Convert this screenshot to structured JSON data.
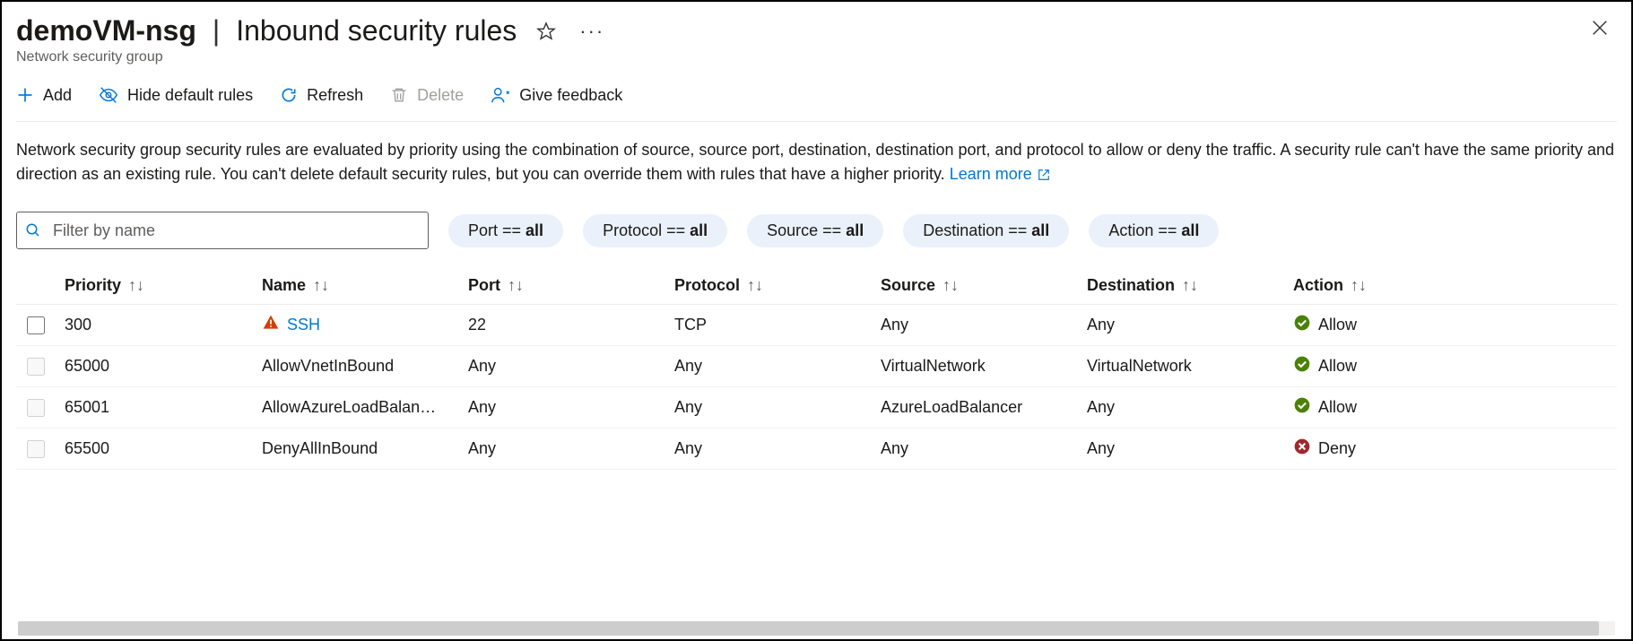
{
  "header": {
    "resource_name": "demoVM-nsg",
    "page_title": "Inbound security rules",
    "subtitle": "Network security group"
  },
  "toolbar": {
    "add": "Add",
    "hide": "Hide default rules",
    "refresh": "Refresh",
    "delete": "Delete",
    "feedback": "Give feedback"
  },
  "description": {
    "text": "Network security group security rules are evaluated by priority using the combination of source, source port, destination, destination port, and protocol to allow or deny the traffic. A security rule can't have the same priority and direction as an existing rule. You can't delete default security rules, but you can override them with rules that have a higher priority.",
    "learn_more": "Learn more"
  },
  "filters": {
    "placeholder": "Filter by name",
    "port": {
      "label": "Port == ",
      "value": "all"
    },
    "protocol": {
      "label": "Protocol == ",
      "value": "all"
    },
    "source": {
      "label": "Source == ",
      "value": "all"
    },
    "destination": {
      "label": "Destination == ",
      "value": "all"
    },
    "action": {
      "label": "Action == ",
      "value": "all"
    }
  },
  "table": {
    "headers": {
      "priority": "Priority",
      "name": "Name",
      "port": "Port",
      "protocol": "Protocol",
      "source": "Source",
      "destination": "Destination",
      "action": "Action"
    },
    "rows": [
      {
        "priority": "300",
        "name": "SSH",
        "port": "22",
        "protocol": "TCP",
        "source": "Any",
        "destination": "Any",
        "action": "Allow",
        "warning": true,
        "is_link": true,
        "status": "allow",
        "enabled": true
      },
      {
        "priority": "65000",
        "name": "AllowVnetInBound",
        "port": "Any",
        "protocol": "Any",
        "source": "VirtualNetwork",
        "destination": "VirtualNetwork",
        "action": "Allow",
        "warning": false,
        "is_link": false,
        "status": "allow",
        "enabled": false
      },
      {
        "priority": "65001",
        "name": "AllowAzureLoadBalan…",
        "port": "Any",
        "protocol": "Any",
        "source": "AzureLoadBalancer",
        "destination": "Any",
        "action": "Allow",
        "warning": false,
        "is_link": false,
        "status": "allow",
        "enabled": false
      },
      {
        "priority": "65500",
        "name": "DenyAllInBound",
        "port": "Any",
        "protocol": "Any",
        "source": "Any",
        "destination": "Any",
        "action": "Deny",
        "warning": false,
        "is_link": false,
        "status": "deny",
        "enabled": false
      }
    ]
  }
}
